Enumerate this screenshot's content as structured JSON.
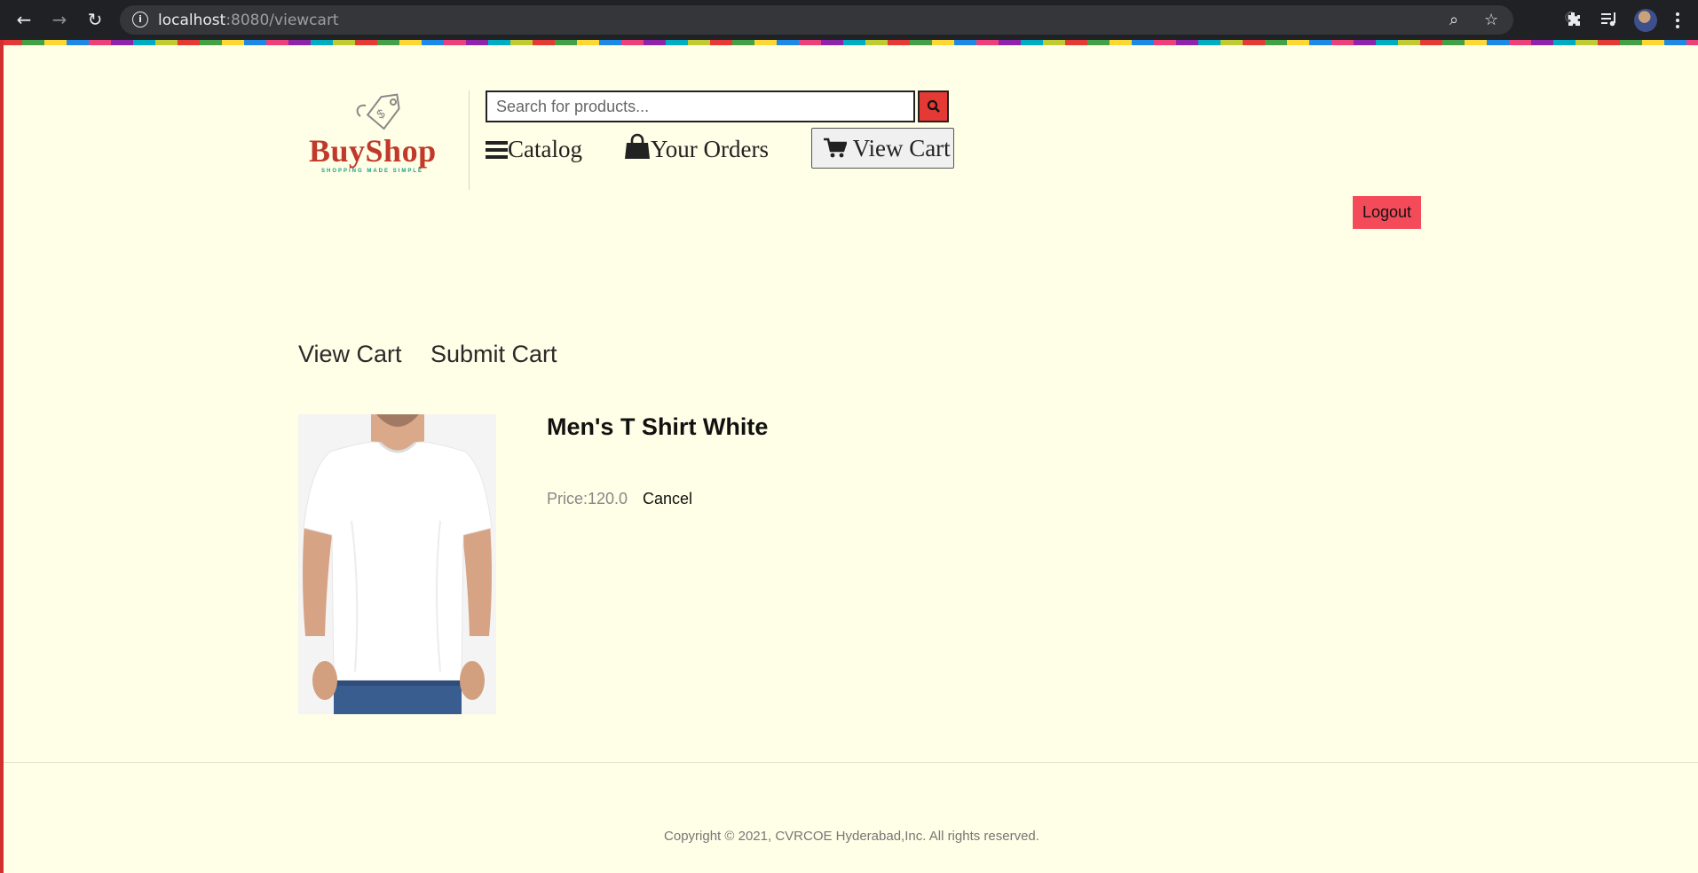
{
  "browser": {
    "url_host": "localhost",
    "url_rest": ":8080/viewcart"
  },
  "header": {
    "logo_text": "BuyShop",
    "logo_tagline": "SHOPPING MADE SIMPLE",
    "search_placeholder": "Search for products...",
    "nav": {
      "catalog": "Catalog",
      "orders": "Your Orders",
      "cart": "View Cart"
    },
    "logout": "Logout"
  },
  "main": {
    "tabs": [
      "View Cart",
      "Submit Cart"
    ],
    "cart_items": [
      {
        "name": "Men's T Shirt White",
        "price": "Price:120.0",
        "action": "Cancel"
      }
    ]
  },
  "footer": {
    "copyright": "Copyright © 2021, CVRCOE Hyderabad,Inc. All rights reserved."
  },
  "colors": {
    "page_bg": "#fffee6",
    "accent_red": "#e53935",
    "logout_bg": "#f44b5a",
    "logo_red": "#c0392b"
  },
  "icons": [
    "back-arrow-icon",
    "forward-arrow-icon",
    "reload-icon",
    "info-icon",
    "zoom-icon",
    "star-icon",
    "extensions-icon",
    "media-icon",
    "menu-dots-icon",
    "search-icon",
    "hamburger-icon",
    "shopping-bag-icon",
    "cart-icon"
  ]
}
